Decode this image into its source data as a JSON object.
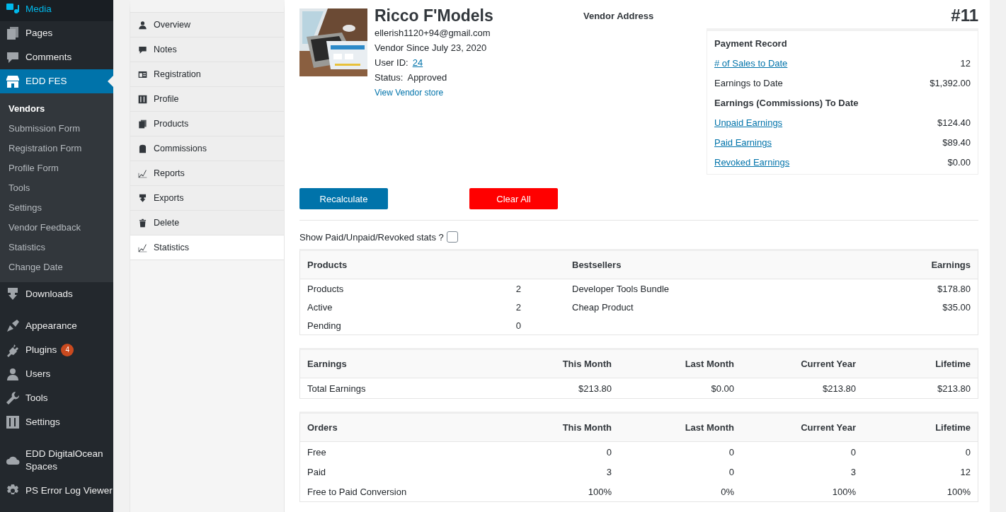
{
  "sidebar": {
    "groups": [
      [
        {
          "label": "Media",
          "selected": false,
          "hovered": true
        },
        {
          "label": "Pages",
          "selected": false,
          "hovered": false
        },
        {
          "label": "Comments",
          "selected": false,
          "hovered": false
        },
        {
          "label": "EDD FES",
          "selected": true,
          "hovered": false,
          "children": [
            {
              "label": "Vendors",
              "selected": true
            },
            {
              "label": "Submission Form",
              "selected": false
            },
            {
              "label": "Registration Form",
              "selected": false
            },
            {
              "label": "Profile Form",
              "selected": false
            },
            {
              "label": "Tools",
              "selected": false
            },
            {
              "label": "Settings",
              "selected": false
            },
            {
              "label": "Vendor Feedback",
              "selected": false
            },
            {
              "label": "Statistics",
              "selected": false
            },
            {
              "label": "Change Date",
              "selected": false
            }
          ]
        },
        {
          "label": "Downloads",
          "selected": false,
          "hovered": false
        }
      ],
      [
        {
          "label": "Appearance",
          "selected": false,
          "hovered": false
        },
        {
          "label": "Plugins",
          "selected": false,
          "hovered": false,
          "badge": "4"
        },
        {
          "label": "Users",
          "selected": false,
          "hovered": false
        },
        {
          "label": "Tools",
          "selected": false,
          "hovered": false
        },
        {
          "label": "Settings",
          "selected": false,
          "hovered": false
        }
      ],
      [
        {
          "label": "EDD DigitalOcean Spaces",
          "selected": false,
          "hovered": false
        },
        {
          "label": "PS Error Log Viewer",
          "selected": false,
          "hovered": false
        }
      ]
    ]
  },
  "vendor_tabs": [
    {
      "label": "Overview",
      "selected": false
    },
    {
      "label": "Notes",
      "selected": false
    },
    {
      "label": "Registration",
      "selected": false
    },
    {
      "label": "Profile",
      "selected": false
    },
    {
      "label": "Products",
      "selected": false
    },
    {
      "label": "Commissions",
      "selected": false
    },
    {
      "label": "Reports",
      "selected": false
    },
    {
      "label": "Exports",
      "selected": false
    },
    {
      "label": "Delete",
      "selected": false
    },
    {
      "label": "Statistics",
      "selected": true
    }
  ],
  "vendor": {
    "name": "Ricco F'Models",
    "email": "ellerish1120+94@gmail.com",
    "since": "Vendor Since July 23, 2020",
    "user_id_label": "User ID:",
    "user_id": "24",
    "status_label": "Status:",
    "status": "Approved",
    "store_link": "View Vendor store",
    "address_heading": "Vendor Address",
    "number": "#11"
  },
  "payment_record": {
    "title": "Payment Record",
    "rows": [
      {
        "kind": "link",
        "label": "# of Sales to Date",
        "value": "12"
      },
      {
        "kind": "text",
        "label": "Earnings to Date",
        "value": "$1,392.00"
      },
      {
        "kind": "heading",
        "label": "Earnings (Commissions) To Date"
      },
      {
        "kind": "link",
        "label": "Unpaid Earnings",
        "value": "$124.40"
      },
      {
        "kind": "link",
        "label": "Paid Earnings",
        "value": "$89.40"
      },
      {
        "kind": "link",
        "label": "Revoked Earnings",
        "value": "$0.00"
      }
    ]
  },
  "buttons": [
    {
      "label": "Recalculate",
      "kind": "primary"
    },
    {
      "label": "Clear All",
      "kind": "danger"
    }
  ],
  "show_stats": {
    "label": "Show Paid/Unpaid/Revoked stats ?",
    "checked": false
  },
  "products_table": {
    "columns": [
      "Products",
      "Bestsellers",
      "Earnings"
    ],
    "counts": [
      {
        "label": "Products",
        "value": "2"
      },
      {
        "label": "Active",
        "value": "2"
      },
      {
        "label": "Pending",
        "value": "0"
      }
    ],
    "bestsellers": [
      {
        "name": "Developer Tools Bundle",
        "earnings": "$178.80"
      },
      {
        "name": "Cheap Product",
        "earnings": "$35.00"
      }
    ]
  },
  "earnings_table": {
    "columns": [
      "Earnings",
      "This Month",
      "Last Month",
      "Current Year",
      "Lifetime"
    ],
    "rows": [
      [
        "Total Earnings",
        "$213.80",
        "$0.00",
        "$213.80",
        "$213.80"
      ]
    ]
  },
  "orders_table": {
    "columns": [
      "Orders",
      "This Month",
      "Last Month",
      "Current Year",
      "Lifetime"
    ],
    "rows": [
      [
        "Free",
        "0",
        "0",
        "0",
        "0"
      ],
      [
        "Paid",
        "3",
        "0",
        "3",
        "12"
      ],
      [
        "Free to Paid Conversion",
        "100%",
        "0%",
        "100%",
        "100%"
      ]
    ]
  }
}
